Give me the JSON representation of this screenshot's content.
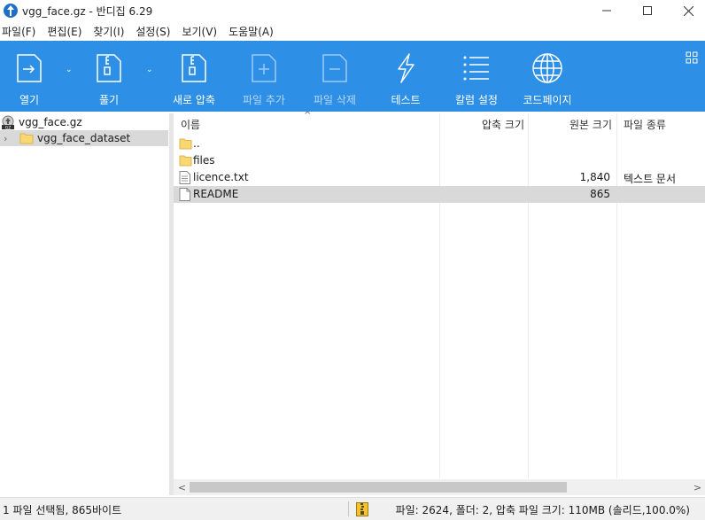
{
  "window": {
    "title": "vgg_face.gz - 반디집 6.29"
  },
  "menu": [
    "파일(F)",
    "편집(E)",
    "찾기(I)",
    "설정(S)",
    "보기(V)",
    "도움말(A)"
  ],
  "toolbar": {
    "open": "열기",
    "extract": "풀기",
    "new_archive": "새로 압축",
    "add_file": "파일 추가",
    "delete_file": "파일 삭제",
    "test": "테스트",
    "column_settings": "칼럼 설정",
    "codepage": "코드페이지"
  },
  "tree": {
    "root": "vgg_face.gz",
    "child": "vgg_face_dataset"
  },
  "columns": {
    "name": "이름",
    "compressed": "압축 크기",
    "original": "원본 크기",
    "type": "파일 종류"
  },
  "files": [
    {
      "name": "..",
      "original": "",
      "type": "",
      "icon": "folder-icon"
    },
    {
      "name": "files",
      "original": "",
      "type": "",
      "icon": "folder-icon"
    },
    {
      "name": "licence.txt",
      "original": "1,840",
      "type": "텍스트 문서",
      "icon": "text-file-icon"
    },
    {
      "name": "README",
      "original": "865",
      "type": "",
      "icon": "file-icon"
    }
  ],
  "status": {
    "selection": "1 파일 선택됨, 865바이트",
    "summary": "파일: 2624, 폴더: 2, 압축 파일 크기: 110MB (솔리드,100.0%)"
  },
  "colors": {
    "toolbar": "#2e8fe6",
    "accent": "#1f6fc8",
    "selection": "#d9d9d9"
  }
}
